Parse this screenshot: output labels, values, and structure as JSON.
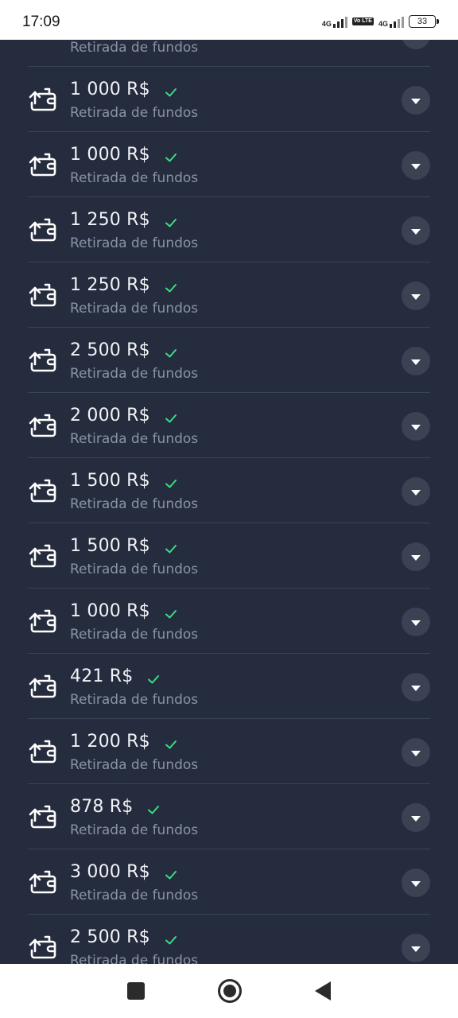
{
  "status_bar": {
    "time": "17:09",
    "network1": "4G",
    "volte": "Vo LTE",
    "network2": "4G",
    "battery": "33"
  },
  "transactions": [
    {
      "amount": "1 000 R$",
      "label": "Retirada de fundos",
      "status": "completed"
    },
    {
      "amount": "1 000 R$",
      "label": "Retirada de fundos",
      "status": "completed"
    },
    {
      "amount": "1 250 R$",
      "label": "Retirada de fundos",
      "status": "completed"
    },
    {
      "amount": "1 250 R$",
      "label": "Retirada de fundos",
      "status": "completed"
    },
    {
      "amount": "2 500 R$",
      "label": "Retirada de fundos",
      "status": "completed"
    },
    {
      "amount": "2 000 R$",
      "label": "Retirada de fundos",
      "status": "completed"
    },
    {
      "amount": "1 500 R$",
      "label": "Retirada de fundos",
      "status": "completed"
    },
    {
      "amount": "1 500 R$",
      "label": "Retirada de fundos",
      "status": "completed"
    },
    {
      "amount": "1 000 R$",
      "label": "Retirada de fundos",
      "status": "completed"
    },
    {
      "amount": "421 R$",
      "label": "Retirada de fundos",
      "status": "completed"
    },
    {
      "amount": "1 200 R$",
      "label": "Retirada de fundos",
      "status": "completed"
    },
    {
      "amount": "878 R$",
      "label": "Retirada de fundos",
      "status": "completed"
    },
    {
      "amount": "3 000 R$",
      "label": "Retirada de fundos",
      "status": "completed"
    },
    {
      "amount": "2 500 R$",
      "label": "Retirada de fundos",
      "status": "completed"
    }
  ],
  "partial_top_row": {
    "label": "Retirada de fundos"
  },
  "colors": {
    "background": "#252c3d",
    "check": "#3ddc84",
    "divider": "#3b4357",
    "subtext": "#8a93a6",
    "button": "#3a4254"
  },
  "icons": {
    "row": "wallet-withdraw-icon",
    "status": "check-icon",
    "expand": "caret-down-icon"
  }
}
